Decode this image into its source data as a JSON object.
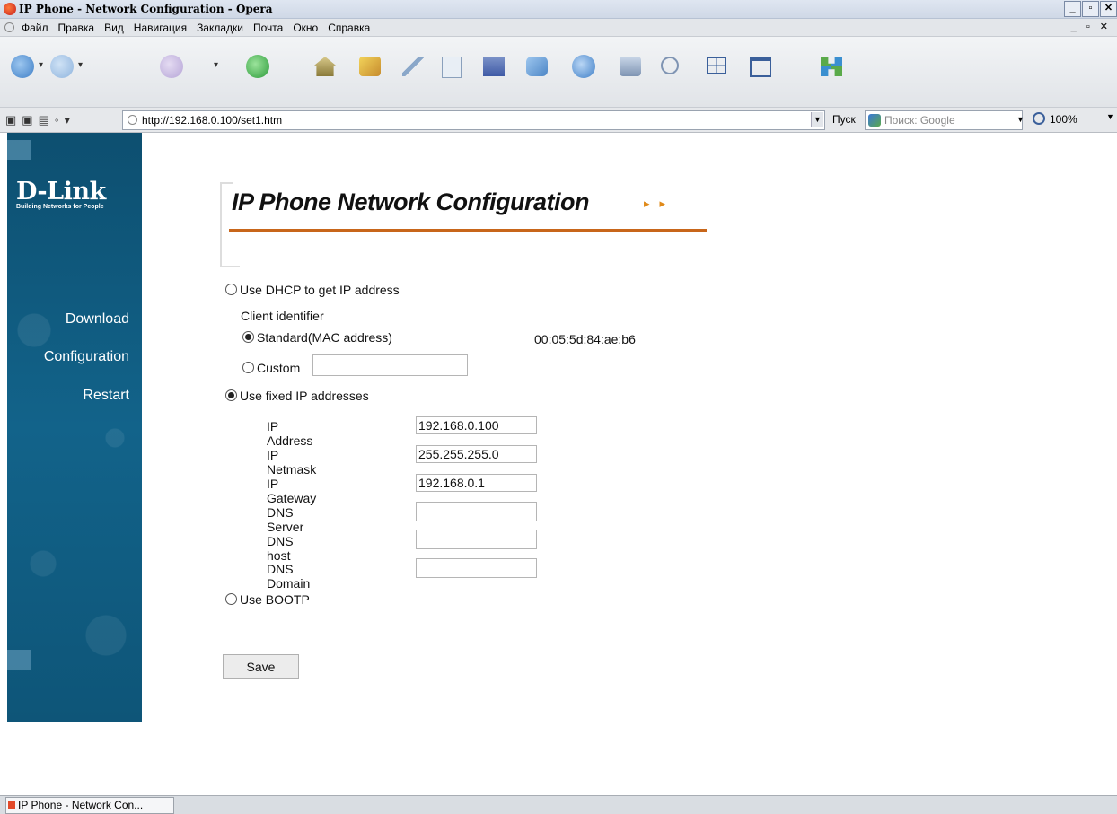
{
  "window": {
    "title": "IP Phone - Network Configuration - Opera",
    "controls": [
      "_",
      "▫",
      "✕"
    ]
  },
  "menu": {
    "items": [
      "Файл",
      "Правка",
      "Вид",
      "Навигация",
      "Закладки",
      "Почта",
      "Окно",
      "Справка"
    ],
    "mdi_controls": "_ ▫ ✕"
  },
  "toolbar": {
    "icons": [
      "back-icon",
      "forward-icon",
      "rewind-icon",
      "reload-icon",
      "home-icon",
      "bookmarks-icon",
      "notes-icon",
      "transfers-icon",
      "mail-icon",
      "chat-icon",
      "info-icon",
      "print-icon",
      "find-icon",
      "tile-icon",
      "cascade-icon",
      "fullscreen-icon"
    ]
  },
  "address_bar": {
    "url": "http://192.168.0.100/set1.htm",
    "go_label": "Пуск",
    "search_placeholder": "Поиск: Google",
    "zoom": "100%"
  },
  "sidebar": {
    "logo_main": "D-Link",
    "logo_sub": "Building Networks for People",
    "nav": [
      "Download",
      "Configuration",
      "Restart"
    ]
  },
  "main": {
    "heading": "IP Phone Network Configuration",
    "dhcp_label": "Use DHCP to get IP address",
    "client_identifier_label": "Client identifier",
    "standard_label": "Standard(MAC address)",
    "mac_address": "00:05:5d:84:ae:b6",
    "custom_label": "Custom",
    "custom_value": "",
    "fixed_label": "Use fixed IP addresses",
    "fields": [
      {
        "label": "IP Address",
        "value": "192.168.0.100"
      },
      {
        "label": "IP Netmask",
        "value": "255.255.255.0"
      },
      {
        "label": "IP Gateway",
        "value": "192.168.0.1"
      },
      {
        "label": "DNS Server",
        "value": ""
      },
      {
        "label": "DNS host",
        "value": ""
      },
      {
        "label": "DNS Domain",
        "value": ""
      }
    ],
    "bootp_label": "Use BOOTP",
    "save_label": "Save",
    "selected_mode": "fixed",
    "selected_client_id": "standard"
  },
  "taskbar": {
    "item": "IP Phone - Network Con..."
  },
  "colors": {
    "sidebar_bg": "#0f5a7c",
    "heading_rule": "#c8661a",
    "heading_arrows": "#e08a1a"
  }
}
